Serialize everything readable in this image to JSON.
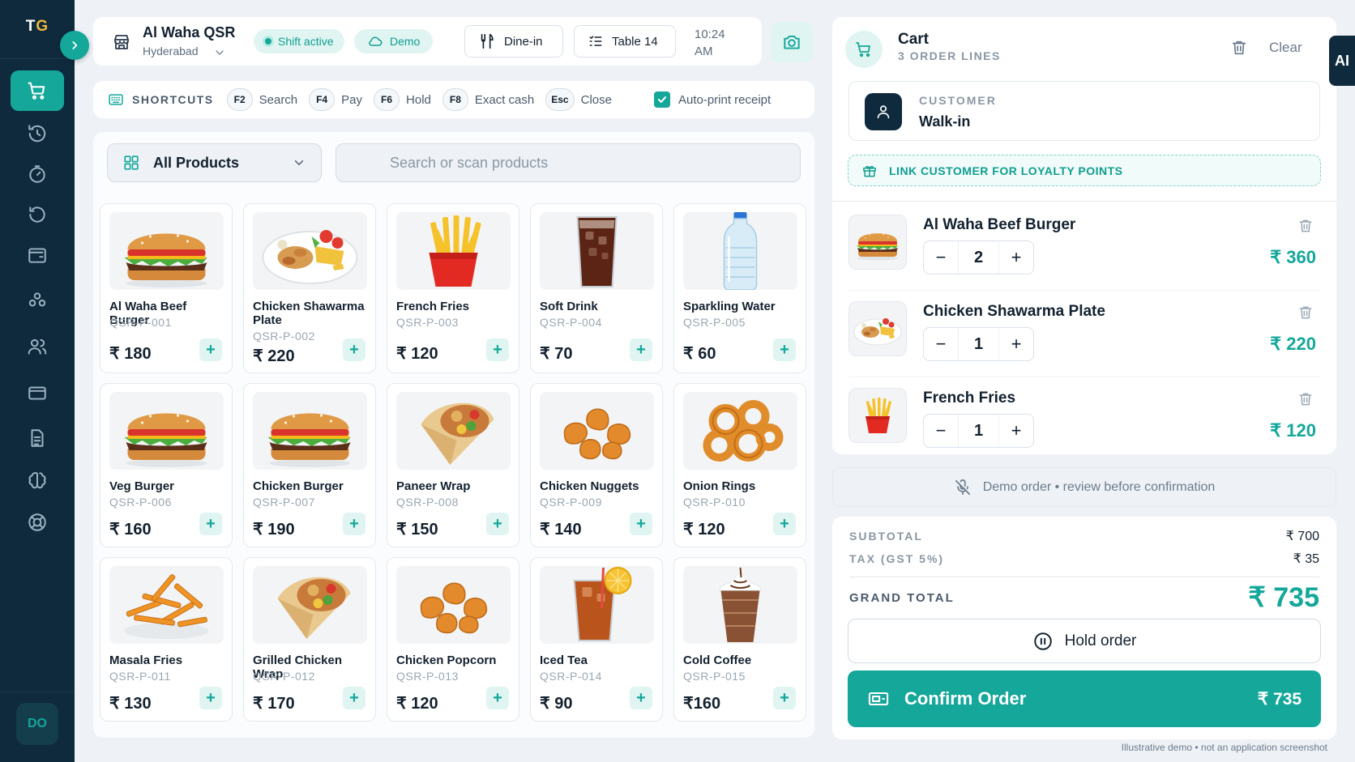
{
  "sidebar": {
    "logo_text": "TG",
    "logo_accent": "G",
    "nav_icons": [
      "cart-icon",
      "history-icon",
      "timer-icon",
      "refresh-icon",
      "wallet-icon",
      "group-icon",
      "users-icon",
      "card-icon",
      "document-icon",
      "brain-icon",
      "support-icon"
    ],
    "user_initials": "DO"
  },
  "header": {
    "store_name": "Al Waha QSR",
    "store_city": "Hyderabad",
    "shift_status": "Shift active",
    "mode": "Demo",
    "order_type": "Dine-in",
    "table": "Table 14",
    "time": "10:24",
    "ampm": "AM"
  },
  "shortcuts": {
    "title": "SHORTCUTS",
    "items": [
      {
        "key": "F2",
        "label": "Search"
      },
      {
        "key": "F4",
        "label": "Pay"
      },
      {
        "key": "F6",
        "label": "Hold"
      },
      {
        "key": "F8",
        "label": "Exact cash"
      },
      {
        "key": "Esc",
        "label": "Close"
      }
    ],
    "auto_print_label": "Auto-print receipt",
    "auto_print_checked": true
  },
  "catalog": {
    "category": "All Products",
    "search_placeholder": "Search or scan products",
    "products": [
      {
        "name": "Al Waha Beef Burger",
        "sku": "QSR-P-001",
        "price": "₹ 180",
        "img": "burger"
      },
      {
        "name": "Chicken Shawarma Plate",
        "sku": "QSR-P-002",
        "price": "₹ 220",
        "img": "plate"
      },
      {
        "name": "French Fries",
        "sku": "QSR-P-003",
        "price": "₹ 120",
        "img": "fries"
      },
      {
        "name": "Soft Drink",
        "sku": "QSR-P-004",
        "price": "₹ 70",
        "img": "cola"
      },
      {
        "name": "Sparkling Water",
        "sku": "QSR-P-005",
        "price": "₹ 60",
        "img": "water"
      },
      {
        "name": "Veg Burger",
        "sku": "QSR-P-006",
        "price": "₹ 160",
        "img": "burger"
      },
      {
        "name": "Chicken Burger",
        "sku": "QSR-P-007",
        "price": "₹ 190",
        "img": "burger"
      },
      {
        "name": "Paneer Wrap",
        "sku": "QSR-P-008",
        "price": "₹ 150",
        "img": "wrap"
      },
      {
        "name": "Chicken Nuggets",
        "sku": "QSR-P-009",
        "price": "₹ 140",
        "img": "nuggets"
      },
      {
        "name": "Onion Rings",
        "sku": "QSR-P-010",
        "price": "₹ 120",
        "img": "rings"
      },
      {
        "name": "Masala Fries",
        "sku": "QSR-P-011",
        "price": "₹ 130",
        "img": "masala"
      },
      {
        "name": "Grilled Chicken Wrap",
        "sku": "QSR-P-012",
        "price": "₹ 170",
        "img": "wrap"
      },
      {
        "name": "Chicken Popcorn",
        "sku": "QSR-P-013",
        "price": "₹ 120",
        "img": "nuggets"
      },
      {
        "name": "Iced Tea",
        "sku": "QSR-P-014",
        "price": "₹ 90",
        "img": "tea"
      },
      {
        "name": "Cold Coffee",
        "sku": "QSR-P-015",
        "price": "₹160",
        "img": "coffee"
      }
    ],
    "add_symbol": "+"
  },
  "cart": {
    "title": "Cart",
    "subtitle": "3 ORDER LINES",
    "clear_label": "Clear",
    "ai_label": "AI",
    "customer_label": "CUSTOMER",
    "customer_value": "Walk-in",
    "loyalty_label": "LINK CUSTOMER FOR LOYALTY POINTS",
    "lines": [
      {
        "name": "Al Waha Beef Burger",
        "qty": "2",
        "total": "₹ 360",
        "img": "burger"
      },
      {
        "name": "Chicken Shawarma Plate",
        "qty": "1",
        "total": "₹ 220",
        "img": "plate"
      },
      {
        "name": "French Fries",
        "qty": "1",
        "total": "₹ 120",
        "img": "fries"
      }
    ],
    "minus": "−",
    "plus": "+",
    "demo_note": "Demo order • review before confirmation"
  },
  "totals": {
    "subtotal_label": "SUBTOTAL",
    "subtotal": "₹ 700",
    "tax_label": "TAX (GST 5%)",
    "tax": "₹ 35",
    "grand_label": "GRAND TOTAL",
    "grand": "₹ 735",
    "hold_label": "Hold order",
    "confirm_label": "Confirm Order",
    "confirm_total": "₹ 735"
  },
  "footnote": "Illustrative demo • not an application screenshot",
  "colors": {
    "accent": "#14a79a",
    "sidebar": "#0f2a3d",
    "logo_accent": "#f0b93b"
  }
}
